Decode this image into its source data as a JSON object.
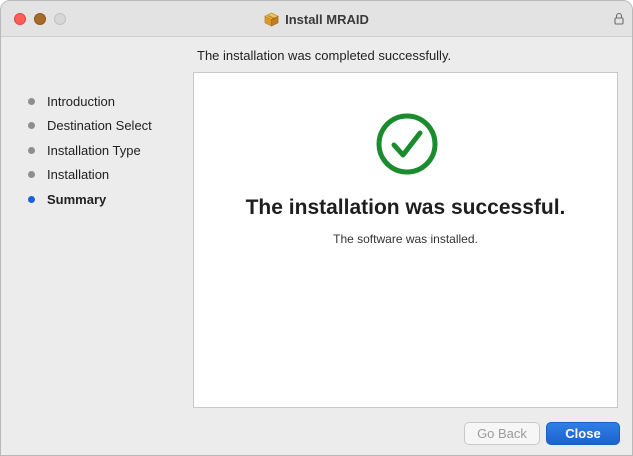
{
  "window": {
    "title": "Install MRAID"
  },
  "header": {
    "text": "The installation was completed successfully."
  },
  "sidebar": {
    "items": [
      {
        "label": "Introduction",
        "active": false
      },
      {
        "label": "Destination Select",
        "active": false
      },
      {
        "label": "Installation Type",
        "active": false
      },
      {
        "label": "Installation",
        "active": false
      },
      {
        "label": "Summary",
        "active": true
      }
    ]
  },
  "content": {
    "title": "The installation was successful.",
    "subtitle": "The software was installed."
  },
  "buttons": {
    "back_label": "Go Back",
    "close_label": "Close"
  },
  "icons": {
    "window": "package-icon",
    "lock": "lock-icon",
    "status": "checkmark-circle-icon"
  },
  "colors": {
    "accent": "#1f5fd8",
    "success": "#1a8c2e",
    "close_traffic": "#fe5f57"
  }
}
